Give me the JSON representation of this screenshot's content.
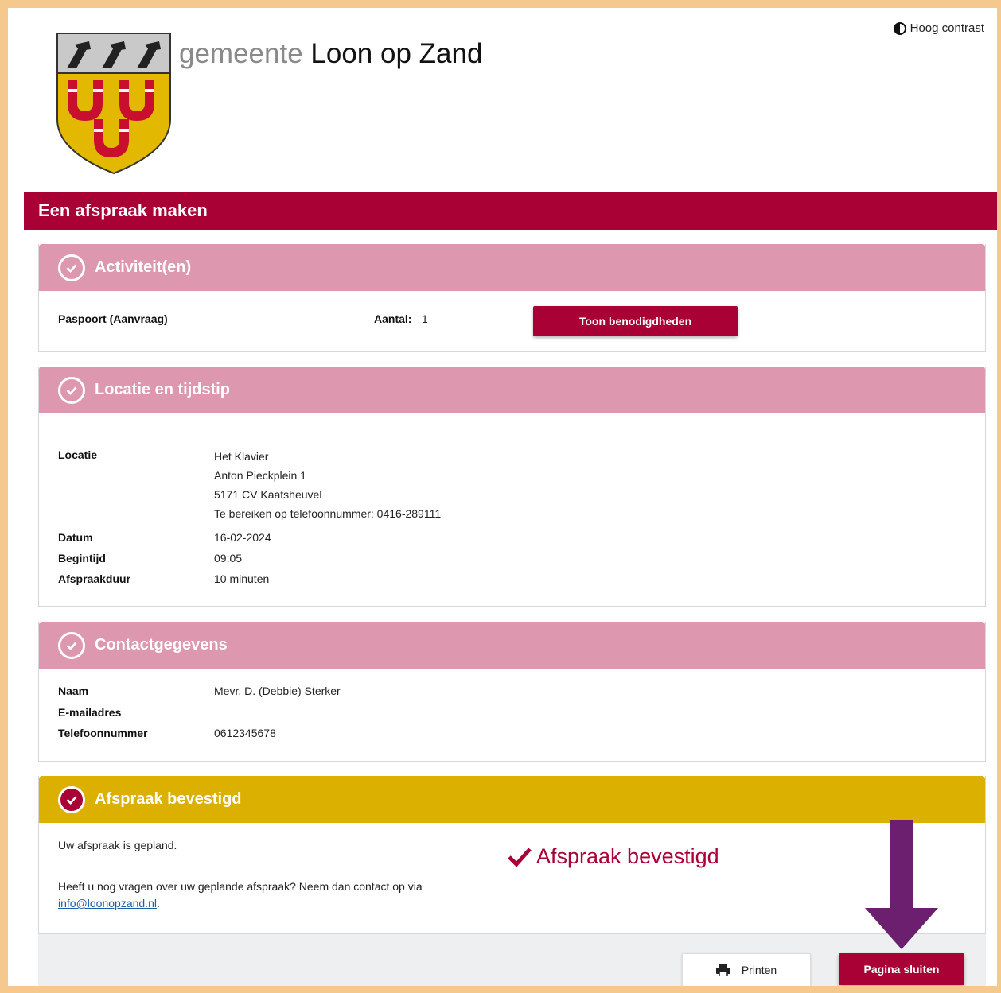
{
  "header": {
    "brand_prefix": "gemeente",
    "brand_name": "Loon op Zand",
    "contrast_label": "Hoog contrast",
    "contrast_icon": "half-circle-contrast-icon"
  },
  "page_title": "Een afspraak maken",
  "activity": {
    "heading": "Activiteit(en)",
    "product": "Paspoort (Aanvraag)",
    "count_label": "Aantal:",
    "count_value": "1",
    "button_label": "Toon benodigdheden"
  },
  "location": {
    "heading": "Locatie en tijdstip",
    "location_label": "Locatie",
    "location_lines": [
      "Het Klavier",
      "Anton Pieckplein 1",
      "5171 CV Kaatsheuvel",
      "Te bereiken op telefoonnummer: 0416-289111"
    ],
    "date_label": "Datum",
    "date_value": "16-02-2024",
    "start_label": "Begintijd",
    "start_value": "09:05",
    "duration_label": "Afspraakduur",
    "duration_value": "10 minuten"
  },
  "contact": {
    "heading": "Contactgegevens",
    "name_label": "Naam",
    "name_value": "Mevr. D. (Debbie) Sterker",
    "email_label": "E-mailadres",
    "phone_label": "Telefoonnummer",
    "phone_value": "0612345678"
  },
  "confirmed": {
    "heading": "Afspraak bevestigd",
    "planned_text": "Uw afspraak is gepland.",
    "question_text": "Heeft u nog vragen over uw geplande afspraak? Neem dan contact op via",
    "email_link": "info@loonopzand.nl",
    "period": ".",
    "big_text": "Afspraak bevestigd"
  },
  "footer": {
    "print_label": "Printen",
    "close_label": "Pagina sluiten"
  },
  "colors": {
    "brand": "#a90036",
    "panel_head": "#dd97ae",
    "confirm_head": "#dcb000",
    "arrow": "#6b1f6e",
    "frame": "#f5c98e"
  }
}
